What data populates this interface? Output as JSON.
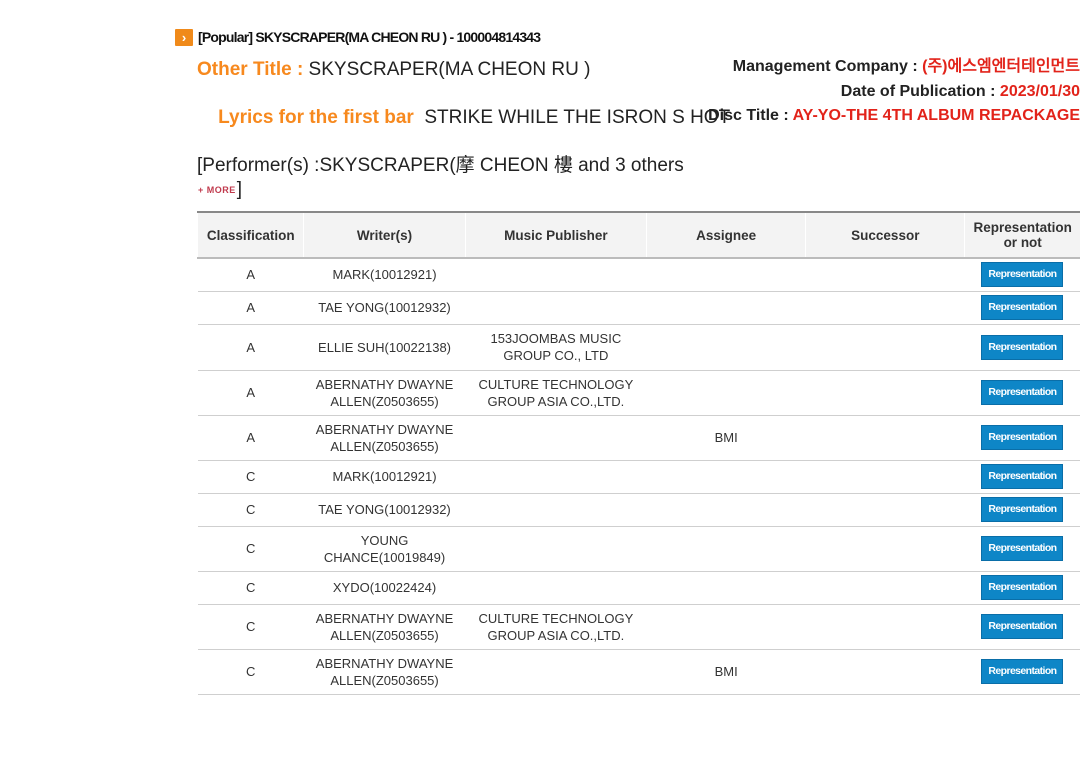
{
  "header": {
    "song_title": "[Popular] SKYSCRAPER(MA CHEON RU ) - 100004814343"
  },
  "info": {
    "other_title_label": "Other Title :",
    "other_title_value": " SKYSCRAPER(MA CHEON RU )",
    "lyrics_label": "Lyrics for the first bar",
    "lyrics_value": "  STRIKE WHILE THE ISRON S HOT",
    "performer_text": "[Performer(s) :SKYSCRAPER(摩 CHEON 樓 and 3 others",
    "more_label": "+ MORE",
    "bracket_close": "]",
    "management_label": "Management Company :",
    "management_value": " (주)에스엠엔터테인먼트",
    "publication_label": "Date of Publication :",
    "publication_value": " 2023/01/30",
    "disc_label": "Disc Title :",
    "disc_value": " AY-YO-THE 4TH ALBUM REPACKAGE"
  },
  "table": {
    "headers": [
      "Classification",
      "Writer(s)",
      "Music Publisher",
      "Assignee",
      "Successor",
      "Representation or not"
    ],
    "rows": [
      {
        "cls": "A",
        "writer": "MARK(10012921)",
        "publisher": "",
        "assignee": "",
        "successor": "",
        "rep": "Representation"
      },
      {
        "cls": "A",
        "writer": "TAE YONG(10012932)",
        "publisher": "",
        "assignee": "",
        "successor": "",
        "rep": "Representation"
      },
      {
        "cls": "A",
        "writer": "ELLIE SUH(10022138)",
        "publisher": "153JOOMBAS MUSIC GROUP CO., LTD",
        "assignee": "",
        "successor": "",
        "rep": "Representation"
      },
      {
        "cls": "A",
        "writer": "ABERNATHY DWAYNE ALLEN(Z0503655)",
        "publisher": "CULTURE TECHNOLOGY GROUP ASIA CO.,LTD.",
        "assignee": "",
        "successor": "",
        "rep": "Representation"
      },
      {
        "cls": "A",
        "writer": "ABERNATHY DWAYNE ALLEN(Z0503655)",
        "publisher": "",
        "assignee": "BMI",
        "successor": "",
        "rep": "Representation"
      },
      {
        "cls": "C",
        "writer": "MARK(10012921)",
        "publisher": "",
        "assignee": "",
        "successor": "",
        "rep": "Representation"
      },
      {
        "cls": "C",
        "writer": "TAE YONG(10012932)",
        "publisher": "",
        "assignee": "",
        "successor": "",
        "rep": "Representation"
      },
      {
        "cls": "C",
        "writer": "YOUNG CHANCE(10019849)",
        "publisher": "",
        "assignee": "",
        "successor": "",
        "rep": "Representation"
      },
      {
        "cls": "C",
        "writer": "XYDO(10022424)",
        "publisher": "",
        "assignee": "",
        "successor": "",
        "rep": "Representation"
      },
      {
        "cls": "C",
        "writer": "ABERNATHY DWAYNE ALLEN(Z0503655)",
        "publisher": "CULTURE TECHNOLOGY GROUP ASIA CO.,LTD.",
        "assignee": "",
        "successor": "",
        "rep": "Representation"
      },
      {
        "cls": "C",
        "writer": "ABERNATHY DWAYNE ALLEN(Z0503655)",
        "publisher": "",
        "assignee": "BMI",
        "successor": "",
        "rep": "Representation"
      }
    ]
  }
}
